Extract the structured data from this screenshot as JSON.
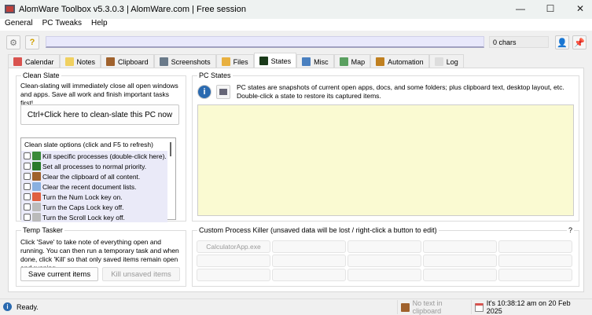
{
  "window": {
    "title": "AlomWare Toolbox v5.3.0.3  |  AlomWare.com  |  Free session",
    "minimize": "—",
    "maximize": "☐",
    "close": "✕"
  },
  "menu": [
    "General",
    "PC Tweaks",
    "Help"
  ],
  "toolbar": {
    "command_value": "",
    "chars": "0 chars"
  },
  "tabs": [
    {
      "label": "Calendar",
      "icon": "calendar-icon",
      "color": "#d9534f"
    },
    {
      "label": "Notes",
      "icon": "notes-icon",
      "color": "#f0d060"
    },
    {
      "label": "Clipboard",
      "icon": "clipboard-icon",
      "color": "#a0622d"
    },
    {
      "label": "Screenshots",
      "icon": "screenshots-icon",
      "color": "#6a7a8a"
    },
    {
      "label": "Files",
      "icon": "files-icon",
      "color": "#e8b040"
    },
    {
      "label": "States",
      "icon": "states-icon",
      "color": "#1a3a1a",
      "active": true
    },
    {
      "label": "Misc",
      "icon": "misc-icon",
      "color": "#4a80c0"
    },
    {
      "label": "Map",
      "icon": "map-icon",
      "color": "#5aa060"
    },
    {
      "label": "Automation",
      "icon": "wand-icon",
      "color": "#c08020"
    },
    {
      "label": "Log",
      "icon": "log-icon",
      "color": "#dddddd"
    }
  ],
  "clean_slate": {
    "title": "Clean Slate",
    "description": "Clean-slating will immediately close all open windows and apps. Save all work and finish important tasks first!",
    "button": "Ctrl+Click here to clean-slate this PC now",
    "options_header": "Clean slate options  (click and F5 to refresh)",
    "options": [
      {
        "label": "Kill specific processes (double-click here).",
        "color": "#3a8a3a"
      },
      {
        "label": "Set all processes to normal priority.",
        "color": "#2a7a2a"
      },
      {
        "label": "Clear the clipboard of all content.",
        "color": "#a0622d"
      },
      {
        "label": "Clear the recent document lists.",
        "color": "#8ab0e0"
      },
      {
        "label": "Turn the Num Lock key on.",
        "color": "#e06040"
      },
      {
        "label": "Turn the Caps Lock key off.",
        "color": "#bbbbbb"
      },
      {
        "label": "Turn the Scroll Lock key off.",
        "color": "#bbbbbb"
      }
    ]
  },
  "pc_states": {
    "title": "PC States",
    "description": "PC states are snapshots of current open apps, docs, and some folders; plus clipboard text, desktop layout, etc. Double-click a state to restore its captured items.",
    "list_bg": "#fafad2"
  },
  "temp_tasker": {
    "title": "Temp Tasker",
    "description": "Click 'Save' to take note of everything open and running. You can then run a temporary task and when done, click 'Kill' so that only saved items remain open and running.",
    "save": "Save current items",
    "kill": "Kill unsaved items"
  },
  "process_killer": {
    "title": "Custom Process Killer  (unsaved data will be lost / right-click a button to edit)",
    "help": "?",
    "buttons": [
      "CalculatorApp.exe",
      "",
      "",
      "",
      "",
      "",
      "",
      "",
      "",
      "",
      "",
      "",
      "",
      "",
      ""
    ]
  },
  "status": {
    "text": "Ready.",
    "clipboard": "No text in clipboard",
    "clock": "It's 10:38:12 am on 20 Feb 2025"
  }
}
